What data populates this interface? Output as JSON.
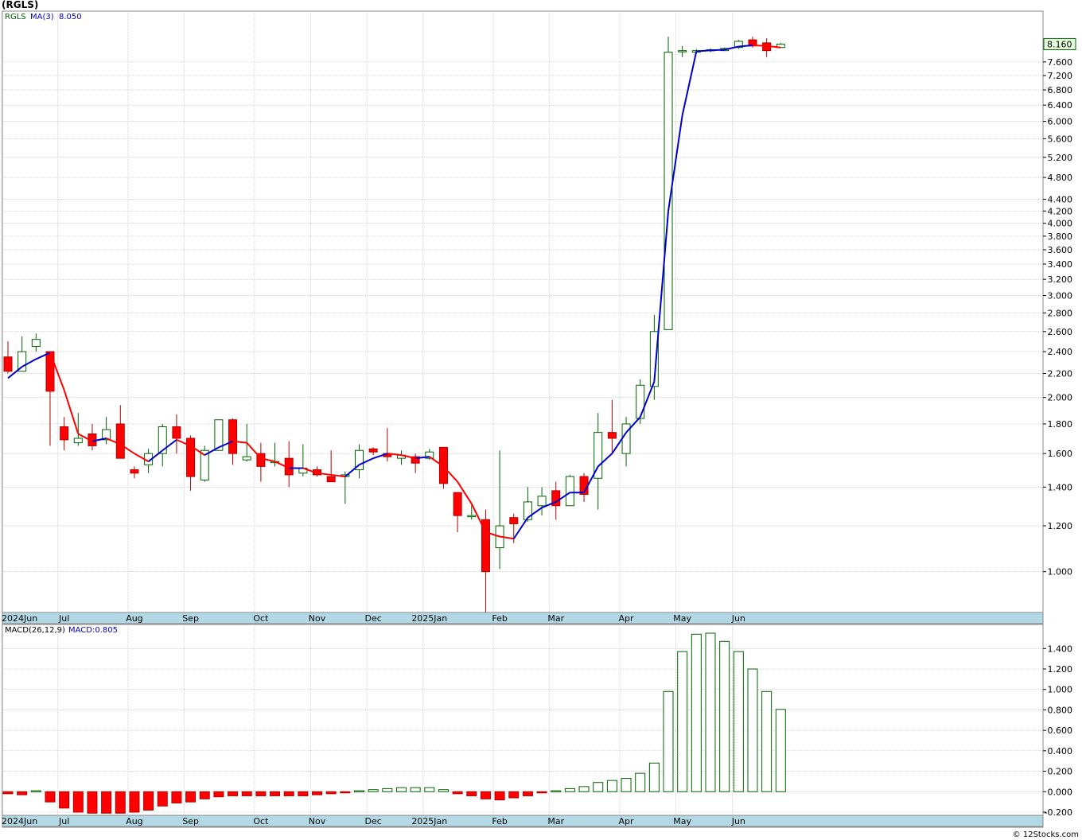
{
  "title": "(RGLS)",
  "footer": "© 12Stocks.com",
  "colors": {
    "up": "#006400",
    "down_fill": "#ff0000",
    "down_stroke": "#b00000",
    "ma_up": "#0000cc",
    "ma_down": "#ff0000",
    "axis_band": "#b3d9e6",
    "grid": "#bbbbbb",
    "last_tag": "#e8ffe0"
  },
  "price_panel": {
    "legend_symbol": "RGLS",
    "legend_ma": "MA(3)",
    "legend_ma_value": "8.050",
    "last_price_label": "8.160",
    "scale": "log",
    "ylim": [
      0.85,
      8.9
    ],
    "y_ticks": [
      "1.000",
      "1.200",
      "1.400",
      "1.600",
      "1.800",
      "2.000",
      "2.200",
      "2.400",
      "2.600",
      "2.800",
      "3.000",
      "3.200",
      "3.400",
      "3.600",
      "3.800",
      "4.000",
      "4.200",
      "4.400",
      "4.800",
      "5.200",
      "5.600",
      "6.000",
      "6.400",
      "6.800",
      "7.200",
      "7.600"
    ],
    "x_labels": [
      "2024Jun",
      "Jul",
      "Aug",
      "Sep",
      "Oct",
      "Nov",
      "Dec",
      "2025Jan",
      "Feb",
      "Mar",
      "Apr",
      "May",
      "Jun"
    ]
  },
  "macd_panel": {
    "legend_label": "MACD(26,12,9)",
    "legend_value": "MACD:0.805",
    "ylim": [
      -0.2,
      1.55
    ],
    "y_ticks": [
      "-0.200",
      "0.000",
      "0.200",
      "0.400",
      "0.600",
      "0.800",
      "1.000",
      "1.200",
      "1.400"
    ],
    "x_labels": [
      "2024Jun",
      "Jul",
      "Aug",
      "Sep",
      "Oct",
      "Nov",
      "Dec",
      "2025Jan",
      "Feb",
      "Mar",
      "Apr",
      "May",
      "Jun"
    ]
  },
  "chart_data": {
    "type": "candlestick",
    "title": "(RGLS)",
    "series_ohlc": [
      [
        2.35,
        2.5,
        2.2,
        2.22
      ],
      [
        2.22,
        2.55,
        2.22,
        2.4
      ],
      [
        2.45,
        2.58,
        2.4,
        2.52
      ],
      [
        2.4,
        2.4,
        1.65,
        2.05
      ],
      [
        1.78,
        1.85,
        1.62,
        1.69
      ],
      [
        1.67,
        1.88,
        1.65,
        1.7
      ],
      [
        1.73,
        1.8,
        1.62,
        1.65
      ],
      [
        1.69,
        1.85,
        1.66,
        1.76
      ],
      [
        1.8,
        1.94,
        1.57,
        1.57
      ],
      [
        1.5,
        1.52,
        1.45,
        1.48
      ],
      [
        1.53,
        1.63,
        1.48,
        1.6
      ],
      [
        1.6,
        1.8,
        1.52,
        1.78
      ],
      [
        1.78,
        1.87,
        1.6,
        1.7
      ],
      [
        1.7,
        1.72,
        1.38,
        1.46
      ],
      [
        1.44,
        1.65,
        1.43,
        1.62
      ],
      [
        1.62,
        1.83,
        1.62,
        1.83
      ],
      [
        1.83,
        1.84,
        1.53,
        1.6
      ],
      [
        1.56,
        1.8,
        1.55,
        1.58
      ],
      [
        1.6,
        1.67,
        1.43,
        1.52
      ],
      [
        1.55,
        1.67,
        1.52,
        1.55
      ],
      [
        1.57,
        1.68,
        1.4,
        1.47
      ],
      [
        1.48,
        1.66,
        1.46,
        1.51
      ],
      [
        1.5,
        1.52,
        1.46,
        1.47
      ],
      [
        1.46,
        1.62,
        1.43,
        1.43
      ],
      [
        1.46,
        1.49,
        1.31,
        1.47
      ],
      [
        1.5,
        1.66,
        1.45,
        1.62
      ],
      [
        1.63,
        1.64,
        1.59,
        1.61
      ],
      [
        1.6,
        1.77,
        1.55,
        1.58
      ],
      [
        1.57,
        1.62,
        1.53,
        1.59
      ],
      [
        1.58,
        1.6,
        1.48,
        1.54
      ],
      [
        1.57,
        1.63,
        1.56,
        1.61
      ],
      [
        1.64,
        1.64,
        1.39,
        1.42
      ],
      [
        1.37,
        1.37,
        1.17,
        1.25
      ],
      [
        1.25,
        1.31,
        1.23,
        1.25
      ],
      [
        1.23,
        1.28,
        0.85,
        1.0
      ],
      [
        1.1,
        1.62,
        1.01,
        1.2
      ],
      [
        1.24,
        1.26,
        1.12,
        1.21
      ],
      [
        1.23,
        1.4,
        1.22,
        1.32
      ],
      [
        1.3,
        1.4,
        1.25,
        1.35
      ],
      [
        1.38,
        1.43,
        1.23,
        1.3
      ],
      [
        1.3,
        1.47,
        1.3,
        1.46
      ],
      [
        1.46,
        1.48,
        1.32,
        1.36
      ],
      [
        1.45,
        1.88,
        1.28,
        1.74
      ],
      [
        1.74,
        1.98,
        1.6,
        1.7
      ],
      [
        1.6,
        1.85,
        1.52,
        1.8
      ],
      [
        1.84,
        2.15,
        1.8,
        2.1
      ],
      [
        2.09,
        2.78,
        1.98,
        2.6
      ],
      [
        2.62,
        8.4,
        2.62,
        7.9
      ],
      [
        7.95,
        8.1,
        7.75,
        7.95
      ],
      [
        7.9,
        8.0,
        7.85,
        7.95
      ],
      [
        7.95,
        8.02,
        7.9,
        7.98
      ],
      [
        7.95,
        8.05,
        7.95,
        8.02
      ],
      [
        8.05,
        8.3,
        8.0,
        8.25
      ],
      [
        8.3,
        8.4,
        8.05,
        8.1
      ],
      [
        8.2,
        8.35,
        7.75,
        7.95
      ],
      [
        8.05,
        8.2,
        8.05,
        8.16
      ]
    ],
    "ma3": [
      2.16,
      2.26,
      2.33,
      2.39,
      2.06,
      1.73,
      1.68,
      1.7,
      1.66,
      1.6,
      1.55,
      1.62,
      1.69,
      1.65,
      1.59,
      1.64,
      1.68,
      1.67,
      1.57,
      1.55,
      1.51,
      1.51,
      1.48,
      1.47,
      1.46,
      1.53,
      1.57,
      1.6,
      1.59,
      1.57,
      1.58,
      1.52,
      1.43,
      1.31,
      1.17,
      1.15,
      1.14,
      1.24,
      1.29,
      1.32,
      1.37,
      1.37,
      1.52,
      1.6,
      1.74,
      1.85,
      2.13,
      4.2,
      6.15,
      7.93,
      7.96,
      7.98,
      8.08,
      8.12,
      8.1,
      8.05
    ],
    "macd": [
      -0.02,
      -0.03,
      0.01,
      -0.1,
      -0.16,
      -0.2,
      -0.21,
      -0.21,
      -0.21,
      -0.2,
      -0.18,
      -0.14,
      -0.11,
      -0.1,
      -0.07,
      -0.05,
      -0.04,
      -0.04,
      -0.04,
      -0.04,
      -0.04,
      -0.04,
      -0.03,
      -0.02,
      -0.01,
      0.01,
      0.02,
      0.03,
      0.04,
      0.04,
      0.04,
      0.02,
      -0.02,
      -0.04,
      -0.07,
      -0.08,
      -0.06,
      -0.04,
      -0.01,
      0.01,
      0.03,
      0.05,
      0.09,
      0.11,
      0.13,
      0.18,
      0.28,
      0.98,
      1.37,
      1.54,
      1.55,
      1.47,
      1.37,
      1.2,
      0.98,
      0.805
    ]
  }
}
